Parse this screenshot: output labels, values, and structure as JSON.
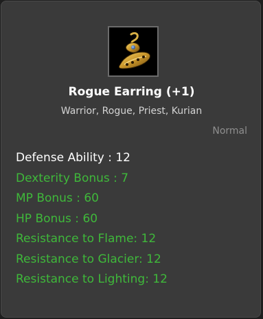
{
  "item": {
    "name": "Rogue Earring (+1)",
    "classes": "Warrior, Rogue, Priest, Kurian",
    "grade": "Normal",
    "icon": "golden-earring-icon"
  },
  "stats": [
    {
      "text": "Defense Ability : 12",
      "color": "#ffffff"
    },
    {
      "text": "Dexterity Bonus : 7",
      "color": "#3fb93a"
    },
    {
      "text": "MP Bonus : 60",
      "color": "#3fb93a"
    },
    {
      "text": "HP Bonus : 60",
      "color": "#3fb93a"
    },
    {
      "text": "Resistance to Flame: 12",
      "color": "#3fb93a"
    },
    {
      "text": "Resistance to Glacier: 12",
      "color": "#3fb93a"
    },
    {
      "text": "Resistance to Lighting: 12",
      "color": "#3fb93a"
    }
  ]
}
